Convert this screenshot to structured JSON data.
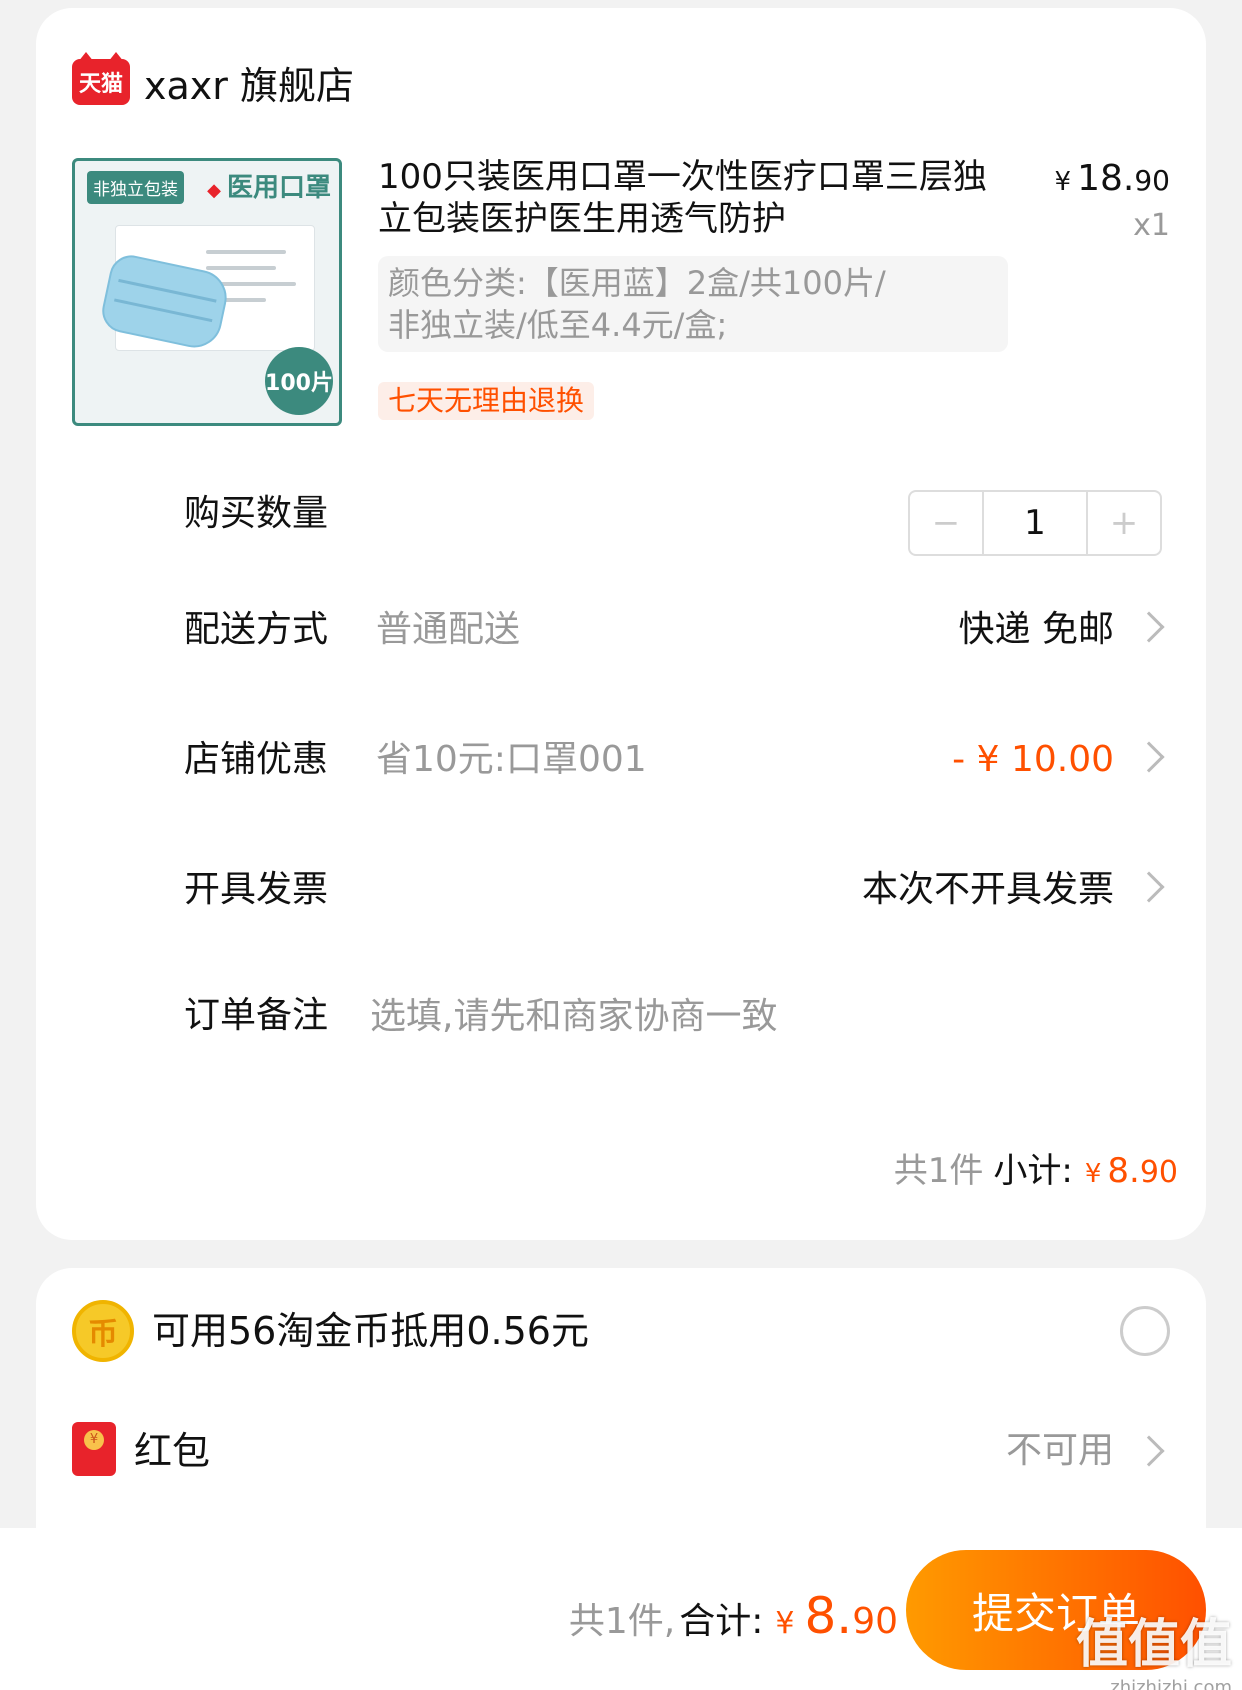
{
  "shop": {
    "badge": "天猫",
    "name": "xaxr 旗舰店"
  },
  "product": {
    "image": {
      "tag": "非独立包装",
      "title": "医用口罩",
      "count": "100片"
    },
    "title": "100只装医用口罩一次性医疗口罩三层独立包装医护医生用透气防护",
    "price_symbol": "¥",
    "price_int": "18.",
    "price_dec": "90",
    "quantity": "x1",
    "sku_line1": "颜色分类:【医用蓝】2盒/共100片/",
    "sku_line2": "非独立装/低至4.4元/盒;",
    "return_tag": "七天无理由退换"
  },
  "rows": {
    "quantity": {
      "label": "购买数量",
      "minus": "−",
      "value": "1",
      "plus": "+"
    },
    "delivery": {
      "label": "配送方式",
      "desc": "普通配送",
      "value": "快递 免邮"
    },
    "discount": {
      "label": "店铺优惠",
      "desc": "省10元:口罩001",
      "value": "- ¥ 10.00"
    },
    "invoice": {
      "label": "开具发票",
      "value": "本次不开具发票"
    },
    "remark": {
      "label": "订单备注",
      "placeholder": "选填,请先和商家协商一致"
    }
  },
  "subtotal": {
    "count": "共1件",
    "label": "小计:",
    "symbol": "¥",
    "int": "8.",
    "dec": "90"
  },
  "coins": {
    "icon_text": "币",
    "text": "可用56淘金币抵用0.56元"
  },
  "hongbao": {
    "label": "红包",
    "value": "不可用"
  },
  "bottom": {
    "count": "共1件,",
    "label": "合计:",
    "symbol": "¥",
    "int": "8.",
    "dec": "90",
    "submit": "提交订单"
  },
  "watermark": {
    "main": "值值值",
    "sub": "zhizhizhi.com"
  },
  "colors": {
    "accent": "#ff5000",
    "tmall_red": "#e8232b",
    "teal": "#3c8a7e"
  }
}
